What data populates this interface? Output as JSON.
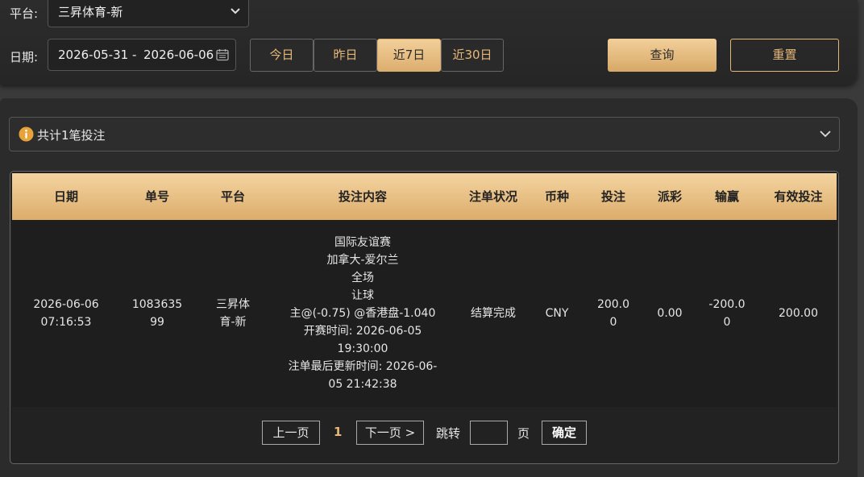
{
  "filters": {
    "platform_label": "平台:",
    "platform_value": "三昇体育-新",
    "date_label": "日期:",
    "date_start": "2026-05-31",
    "date_sep": "-",
    "date_end": "2026-06-06",
    "quick_ranges": [
      "今日",
      "昨日",
      "近7日",
      "近30日"
    ],
    "active_range": "近7日",
    "query_label": "查询",
    "reset_label": "重置"
  },
  "summary": {
    "text": "共计1笔投注"
  },
  "table": {
    "headers": [
      "日期",
      "单号",
      "平台",
      "投注内容",
      "注单状况",
      "币种",
      "投注",
      "派彩",
      "输赢",
      "有效投注"
    ],
    "rows": [
      {
        "date": [
          "2026-06-06",
          "07:16:53"
        ],
        "order_no": [
          "1083635",
          "99"
        ],
        "platform": [
          "三昇体",
          "育-新"
        ],
        "content": [
          "国际友谊赛",
          "加拿大-爱尔兰",
          "全场",
          "让球",
          "主@(-0.75) @香港盘-1.040",
          "开赛时间: 2026-06-05",
          "19:30:00",
          "注单最后更新时间: 2026-06-",
          "05 21:42:38"
        ],
        "status": "结算完成",
        "currency": "CNY",
        "stake": [
          "200.0",
          "0"
        ],
        "payout": "0.00",
        "win_loss": [
          "-200.0",
          "0"
        ],
        "valid_bet": "200.00"
      }
    ]
  },
  "pagination": {
    "prev_label": "上一页",
    "current_page": "1",
    "next_label": "下一页 >",
    "jump_label": "跳转",
    "page_unit": "页",
    "confirm_label": "确定"
  },
  "colors": {
    "accent": "#e6b878",
    "header_gold": "#dcac6b"
  }
}
